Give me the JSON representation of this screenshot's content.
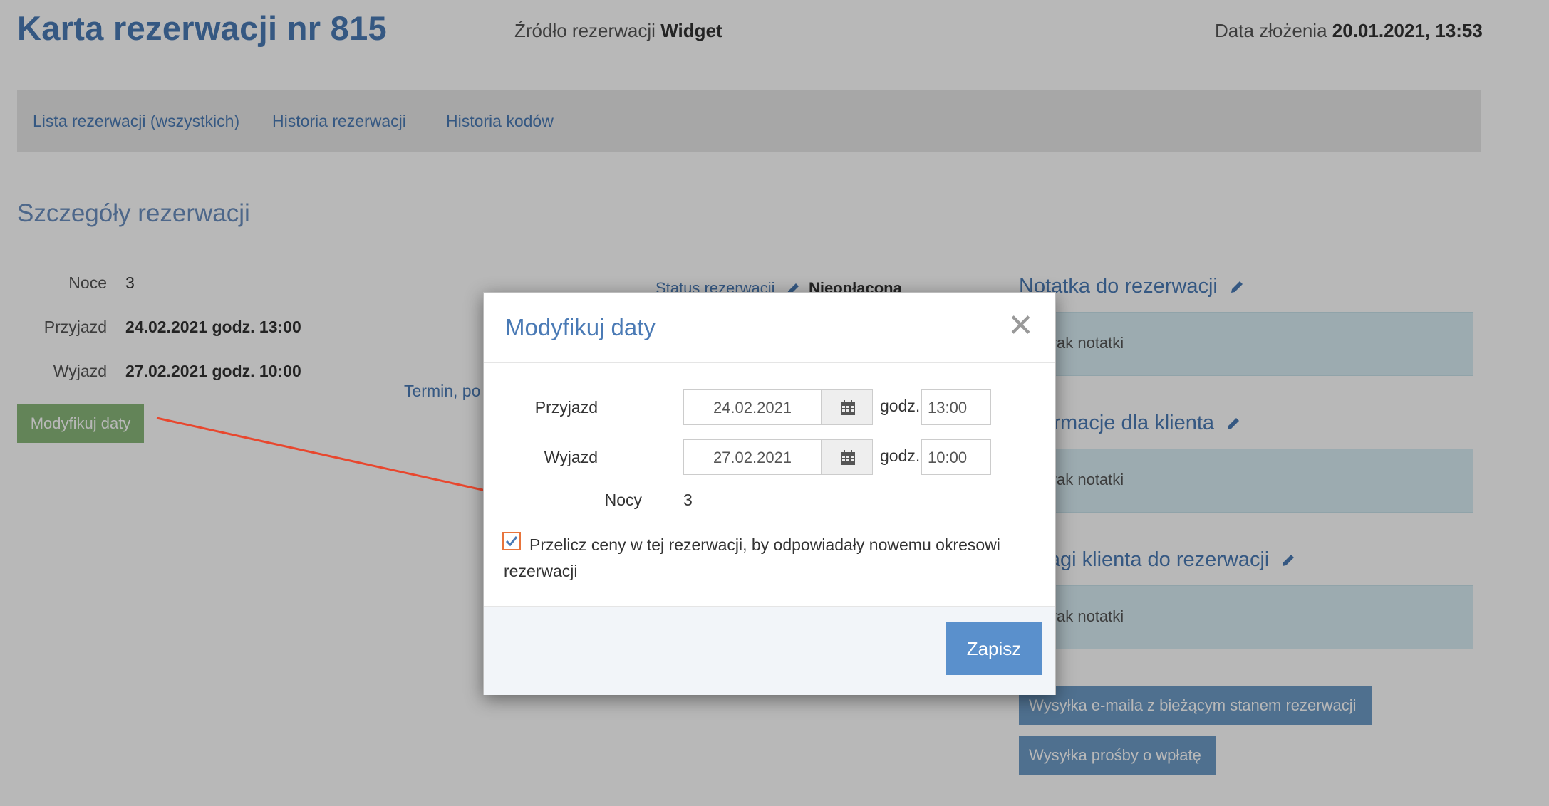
{
  "header": {
    "title": "Karta rezerwacji nr 815",
    "source_label": "Źródło rezerwacji",
    "source_value": "Widget",
    "date_label": "Data złożenia",
    "date_value": "20.01.2021, 13:53"
  },
  "nav": {
    "items": [
      {
        "label": "Lista rezerwacji (wszystkich)"
      },
      {
        "label": "Historia rezerwacji"
      },
      {
        "label": "Historia kodów"
      }
    ]
  },
  "details": {
    "section_title": "Szczegóły rezerwacji",
    "nights_label": "Noce",
    "nights_value": "3",
    "arrival_label": "Przyjazd",
    "arrival_value": "24.02.2021 godz. 13:00",
    "departure_label": "Wyjazd",
    "departure_value": "27.02.2021 godz. 10:00",
    "modify_button": "Modyfikuj daty",
    "term_link": "Termin, po"
  },
  "status": {
    "label": "Status rezerwacji",
    "value": "Nieopłacona"
  },
  "side": {
    "note_title": "Notatka do rezerwacji",
    "note_text": "Brak notatki",
    "client_info_title": "Informacje dla klienta",
    "client_info_text": "Brak notatki",
    "client_remarks_title": "Uwagi klienta do rezerwacji",
    "client_remarks_text": "Brak notatki",
    "email_button": "Wysyłka e-maila z bieżącym stanem rezerwacji",
    "payment_button": "Wysyłka prośby o wpłatę"
  },
  "modal": {
    "title": "Modyfikuj daty",
    "close_symbol": "✕",
    "arrival_label": "Przyjazd",
    "arrival_date": "24.02.2021",
    "arrival_godz": "godz.",
    "arrival_time": "13:00",
    "departure_label": "Wyjazd",
    "departure_date": "27.02.2021",
    "departure_godz": "godz.",
    "departure_time": "10:00",
    "nights_label": "Nocy",
    "nights_value": "3",
    "recalc_checked": true,
    "recalc_text": "Przelicz ceny w tej rezerwacji, by odpowiadały nowemu okresowi rezerwacji",
    "save_button": "Zapisz"
  },
  "colors": {
    "accent": "#4a7ab5",
    "arrow": "#e8472e",
    "checkbox_border": "#e8743b",
    "save_button": "#5a90cc"
  }
}
